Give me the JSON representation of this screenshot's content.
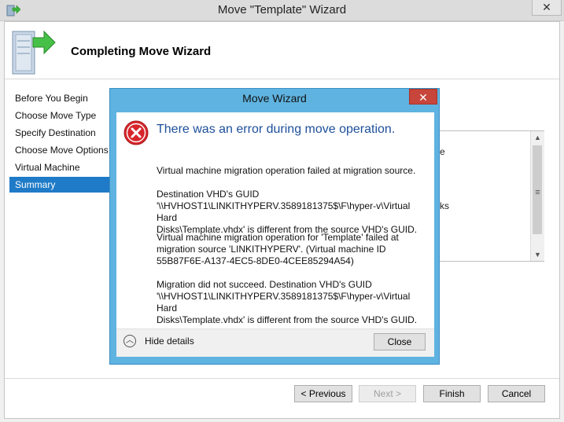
{
  "window": {
    "title": "Move \"Template\" Wizard",
    "close_glyph": "✕"
  },
  "header": {
    "title": "Completing Move Wizard"
  },
  "nav": {
    "items": [
      {
        "label": "Before You Begin",
        "selected": false
      },
      {
        "label": "Choose Move Type",
        "selected": false
      },
      {
        "label": "Specify Destination",
        "selected": false
      },
      {
        "label": "Choose Move Options",
        "selected": false
      },
      {
        "label": "Virtual Machine",
        "selected": false
      },
      {
        "label": "Summary",
        "selected": true
      }
    ]
  },
  "content": {
    "fragment_1": "e",
    "fragment_2": "ks"
  },
  "footer": {
    "previous_label": "< Previous",
    "next_label": "Next >",
    "finish_label": "Finish",
    "cancel_label": "Cancel"
  },
  "dialog": {
    "title": "Move Wizard",
    "close_glyph": "✕",
    "heading": "There was an error during move operation.",
    "messages": [
      "Virtual machine migration operation failed at migration source.",
      "Destination VHD's GUID\n'\\\\HVHOST1\\LINKITHYPERV.3589181375$\\F\\hyper-v\\Virtual Hard\nDisks\\Template.vhdx' is different from the source VHD's GUID.",
      "Virtual machine migration operation for 'Template' failed at\nmigration source 'LINKITHYPERV'. (Virtual machine ID\n55B87F6E-A137-4EC5-8DE0-4CEE85294A54)",
      "Migration did not succeed. Destination VHD's GUID\n'\\\\HVHOST1\\LINKITHYPERV.3589181375$\\F\\hyper-v\\Virtual Hard\nDisks\\Template.vhdx' is different from the source VHD's GUID."
    ],
    "hide_details_label": "Hide details",
    "close_button_label": "Close"
  },
  "colors": {
    "selection_blue": "#1f7bc7",
    "dialog_frame": "#5fb3e0",
    "dialog_close": "#c7453a",
    "error_red": "#d7262b",
    "heading_blue": "#1d4f9a"
  }
}
